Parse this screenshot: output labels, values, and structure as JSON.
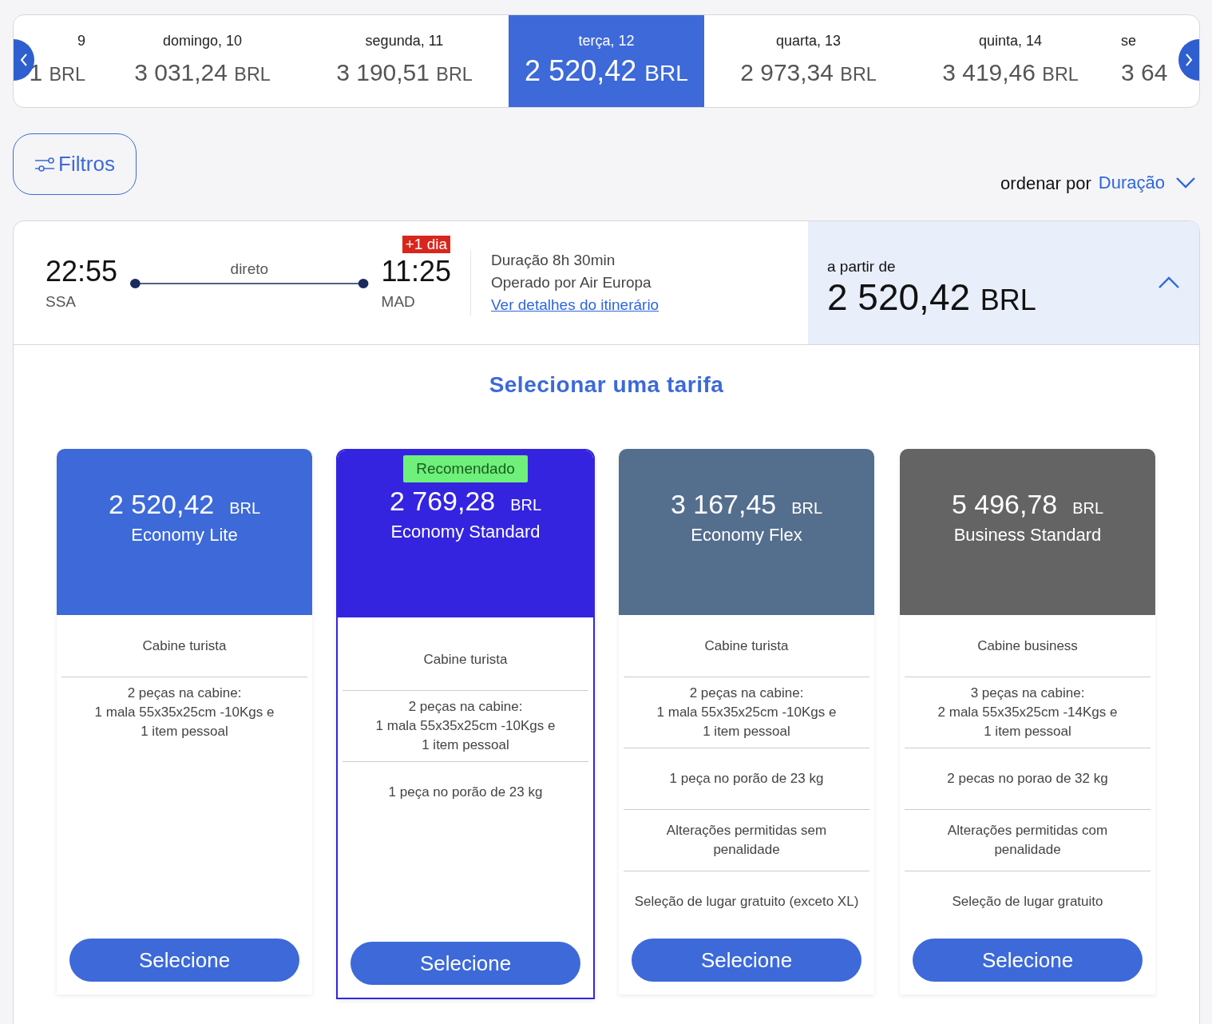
{
  "date_strip": {
    "days": [
      {
        "day": "9",
        "amount": "1",
        "currency": "BRL",
        "selected": false
      },
      {
        "day": "domingo, 10",
        "amount": "3 031,24",
        "currency": "BRL",
        "selected": false
      },
      {
        "day": "segunda, 11",
        "amount": "3 190,51",
        "currency": "BRL",
        "selected": false
      },
      {
        "day": "terça, 12",
        "amount": "2 520,42",
        "currency": "BRL",
        "selected": true
      },
      {
        "day": "quarta, 13",
        "amount": "2 973,34",
        "currency": "BRL",
        "selected": false
      },
      {
        "day": "quinta, 14",
        "amount": "3 419,46",
        "currency": "BRL",
        "selected": false
      },
      {
        "day": "se",
        "amount": "3 64",
        "selected": false
      }
    ]
  },
  "filters_button": "Filtros",
  "sort": {
    "label": "ordenar por",
    "value": "Duração"
  },
  "flight": {
    "departure_time": "22:55",
    "departure_airport": "SSA",
    "stops": "direto",
    "arrival_time": "11:25",
    "arrival_airport": "MAD",
    "day_offset": "+1 dia",
    "duration": "Duração 8h 30min",
    "operator": "Operado por Air Europa",
    "details_link": "Ver detalhes do itinerário",
    "price_label": "a partir de",
    "price": "2 520,42",
    "currency": "BRL",
    "expanded": true
  },
  "fares_title": "Selecionar uma tarifa",
  "fares": [
    {
      "price": "2 520,42",
      "currency": "BRL",
      "name": "Economy Lite",
      "color": "#3d69d9",
      "recommended": false,
      "features": [
        "Cabine turista",
        "2 peças na cabine:\n1 mala 55x35x25cm -10Kgs e\n1 item pessoal"
      ],
      "button": "Selecione"
    },
    {
      "badge": "Recomendado",
      "price": "2 769,28",
      "currency": "BRL",
      "name": "Economy Standard",
      "color": "#3424e0",
      "recommended": true,
      "features": [
        "Cabine turista",
        "2 peças na cabine:\n1 mala 55x35x25cm -10Kgs e\n1 item pessoal",
        "1 peça no porão de 23 kg"
      ],
      "button": "Selecione"
    },
    {
      "price": "3 167,45",
      "currency": "BRL",
      "name": "Economy Flex",
      "color": "#546e8e",
      "recommended": false,
      "features": [
        "Cabine turista",
        "2 peças na cabine:\n1 mala 55x35x25cm -10Kgs e\n1 item pessoal",
        "1 peça no porão de 23 kg",
        "Alterações permitidas sem\npenalidade",
        "Seleção de lugar gratuito (exceto XL)"
      ],
      "button": "Selecione"
    },
    {
      "price": "5 496,78",
      "currency": "BRL",
      "name": "Business Standard",
      "color": "#646464",
      "recommended": false,
      "features": [
        "Cabine business",
        "3 peças na cabine:\n2 mala 55x35x25cm -14Kgs e\n1 item pessoal",
        "2 pecas no porao de 32 kg",
        "Alterações permitidas com\npenalidade",
        "Seleção de lugar gratuito"
      ],
      "button": "Selecione"
    }
  ]
}
